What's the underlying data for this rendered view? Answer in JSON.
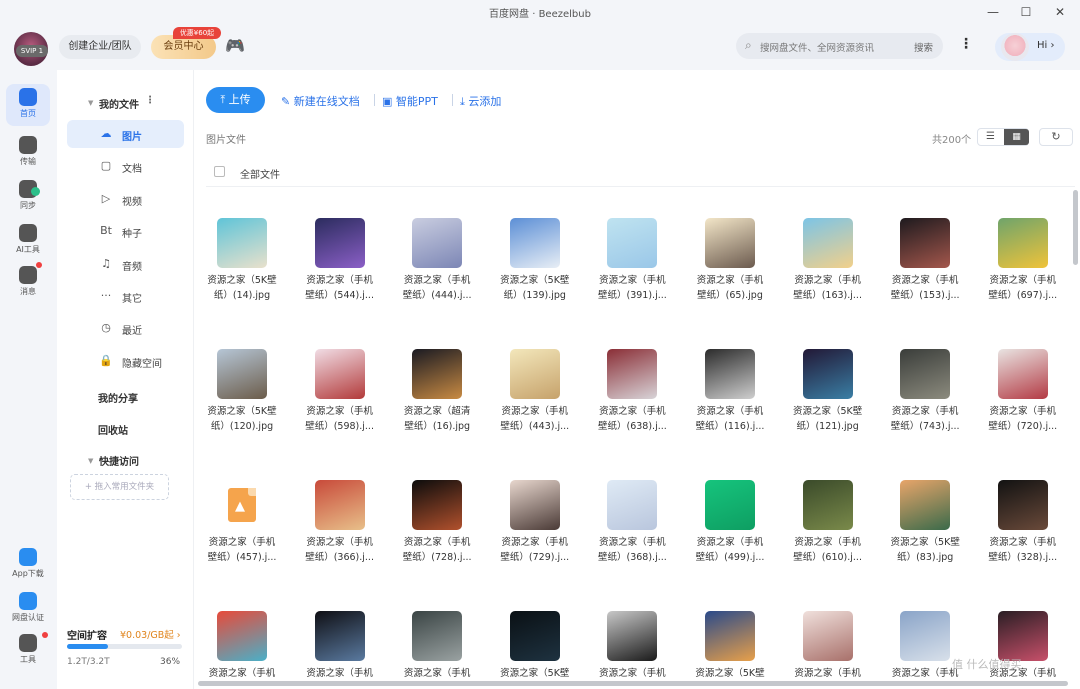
{
  "window": {
    "title": "百度网盘 · Beezelbub",
    "minimize": "—",
    "maximize": "☐",
    "close": "✕"
  },
  "header": {
    "svip": "SVIP 1",
    "team_btn": "创建企业/团队",
    "vip_btn": "会员中心",
    "promo": "优惠¥60起",
    "search_placeholder": "搜网盘文件、全网资源资讯",
    "search_btn": "搜索",
    "more": "⋮",
    "hi": "Hi ›"
  },
  "rail": {
    "items": [
      {
        "label": "首页",
        "color": "#2a72e8"
      },
      {
        "label": "传输",
        "color": "#555555"
      },
      {
        "label": "同步",
        "color": "#555555"
      },
      {
        "label": "AI工具",
        "color": "#555555"
      },
      {
        "label": "消息",
        "color": "#555555"
      }
    ],
    "bottom": [
      {
        "label": "App下载",
        "color": "#2a8df0"
      },
      {
        "label": "网盘认证",
        "color": "#2a8df0"
      },
      {
        "label": "工具",
        "color": "#555555"
      }
    ]
  },
  "sidenav": {
    "my_files": "我的文件",
    "items": [
      {
        "icon": "☁",
        "label": "图片",
        "active": true
      },
      {
        "icon": "▢",
        "label": "文档",
        "active": false
      },
      {
        "icon": "▷",
        "label": "视频",
        "active": false
      },
      {
        "icon": "Bt",
        "label": "种子",
        "active": false
      },
      {
        "icon": "♫",
        "label": "音频",
        "active": false
      },
      {
        "icon": "···",
        "label": "其它",
        "active": false
      },
      {
        "icon": "◷",
        "label": "最近",
        "active": false
      },
      {
        "icon": "🔒",
        "label": "隐藏空间",
        "active": false
      }
    ],
    "my_share": "我的分享",
    "recycle": "回收站",
    "quick_access": "快捷访问",
    "drop_hint": "+ 拖入常用文件夹",
    "quota": {
      "title": "空间扩容",
      "price": "¥0.03/GB起 ›",
      "used": "1.2T/3.2T",
      "pct": "36%",
      "fraction": 0.36
    }
  },
  "toolbar": {
    "upload": "上传",
    "new_doc": "新建在线文档",
    "smart_ppt": "智能PPT",
    "cloud_add": "云添加"
  },
  "list": {
    "crumb": "图片文件",
    "count": "共200个",
    "all_files": "全部文件",
    "list_view": "☰",
    "grid_view": "▦",
    "refresh": "↻"
  },
  "files": [
    {
      "l1": "资源之家（5K壁",
      "l2": "纸）(14).jpg",
      "c1": "#5fc4d8",
      "c2": "#e9e1cc"
    },
    {
      "l1": "资源之家（手机",
      "l2": "壁纸）(544).j...",
      "c1": "#2b2c5e",
      "c2": "#8b5fc7"
    },
    {
      "l1": "资源之家（手机",
      "l2": "壁纸）(444).j...",
      "c1": "#c9cde0",
      "c2": "#7c86b5"
    },
    {
      "l1": "资源之家（5K壁",
      "l2": "纸）(139).jpg",
      "c1": "#5c8fd6",
      "c2": "#e8eef5"
    },
    {
      "l1": "资源之家（手机",
      "l2": "壁纸）(391).j...",
      "c1": "#bfe3f0",
      "c2": "#9ac7e8"
    },
    {
      "l1": "资源之家（手机",
      "l2": "壁纸）(65).jpg",
      "c1": "#f3e6c8",
      "c2": "#6b5a4e"
    },
    {
      "l1": "资源之家（手机",
      "l2": "壁纸）(163).j...",
      "c1": "#7cc4e6",
      "c2": "#f2d08a"
    },
    {
      "l1": "资源之家（手机",
      "l2": "壁纸）(153).j...",
      "c1": "#1e1a1e",
      "c2": "#a4574c"
    },
    {
      "l1": "资源之家（手机",
      "l2": "壁纸）(697).j...",
      "c1": "#6fa46b",
      "c2": "#f0c33a"
    },
    {
      "l1": "资源之家（5K壁",
      "l2": "纸）(120).jpg",
      "c1": "#b6c6d6",
      "c2": "#6b5c4a"
    },
    {
      "l1": "资源之家（手机",
      "l2": "壁纸）(598).j...",
      "c1": "#f1dde5",
      "c2": "#b23a3a"
    },
    {
      "l1": "资源之家（超清",
      "l2": "壁纸）(16).jpg",
      "c1": "#1a1a22",
      "c2": "#c98b43"
    },
    {
      "l1": "资源之家（手机",
      "l2": "壁纸）(443).j...",
      "c1": "#f3e7bb",
      "c2": "#c6a26b"
    },
    {
      "l1": "资源之家（手机",
      "l2": "壁纸）(638).j...",
      "c1": "#8a2e36",
      "c2": "#d8d4d8"
    },
    {
      "l1": "资源之家（手机",
      "l2": "壁纸）(116).j...",
      "c1": "#2b2b2b",
      "c2": "#cfcfcf"
    },
    {
      "l1": "资源之家（5K壁",
      "l2": "纸）(121).jpg",
      "c1": "#221836",
      "c2": "#3a7fa5"
    },
    {
      "l1": "资源之家（手机",
      "l2": "壁纸）(743).j...",
      "c1": "#3a3d3a",
      "c2": "#8c8b7e"
    },
    {
      "l1": "资源之家（手机",
      "l2": "壁纸）(720).j...",
      "c1": "#e9e4e2",
      "c2": "#b33a44"
    },
    {
      "l1": "资源之家（手机",
      "l2": "壁纸）(457).j...",
      "c1": "#ffffff",
      "c2": "#ffffff",
      "doc": true
    },
    {
      "l1": "资源之家（手机",
      "l2": "壁纸）(366).j...",
      "c1": "#c84a3a",
      "c2": "#e8c08a"
    },
    {
      "l1": "资源之家（手机",
      "l2": "壁纸）(728).j...",
      "c1": "#0c0c0c",
      "c2": "#b2512d"
    },
    {
      "l1": "资源之家（手机",
      "l2": "壁纸）(729).j...",
      "c1": "#e8d7ce",
      "c2": "#4a3a36"
    },
    {
      "l1": "资源之家（手机",
      "l2": "壁纸）(368).j...",
      "c1": "#dfeaf5",
      "c2": "#b9c6dd"
    },
    {
      "l1": "资源之家（手机",
      "l2": "壁纸）(499).j...",
      "c1": "#16c47d",
      "c2": "#0e9e62"
    },
    {
      "l1": "资源之家（手机",
      "l2": "壁纸）(610).j...",
      "c1": "#3a4a2a",
      "c2": "#7a8a4a"
    },
    {
      "l1": "资源之家（5K壁",
      "l2": "纸）(83).jpg",
      "c1": "#e8a56a",
      "c2": "#3a6a4a"
    },
    {
      "l1": "资源之家（手机",
      "l2": "壁纸）(328).j...",
      "c1": "#121212",
      "c2": "#6a4a3a"
    },
    {
      "l1": "资源之家（手机",
      "l2": "",
      "c1": "#e84a3a",
      "c2": "#4ab0c8"
    },
    {
      "l1": "资源之家（手机",
      "l2": "",
      "c1": "#0f0f14",
      "c2": "#5a7aa0"
    },
    {
      "l1": "资源之家（手机",
      "l2": "",
      "c1": "#3a4444",
      "c2": "#9aa2a2"
    },
    {
      "l1": "资源之家（5K壁",
      "l2": "",
      "c1": "#0a1014",
      "c2": "#1e3240"
    },
    {
      "l1": "资源之家（手机",
      "l2": "",
      "c1": "#c8c8c8",
      "c2": "#1a1a1a"
    },
    {
      "l1": "资源之家（5K壁",
      "l2": "",
      "c1": "#2a4a8a",
      "c2": "#e8a04a"
    },
    {
      "l1": "资源之家（手机",
      "l2": "",
      "c1": "#f0e0dc",
      "c2": "#a8706a"
    },
    {
      "l1": "资源之家（手机",
      "l2": "",
      "c1": "#8aa4c8",
      "c2": "#d8e0ea"
    },
    {
      "l1": "资源之家（手机",
      "l2": "",
      "c1": "#2a1e24",
      "c2": "#c8506a"
    }
  ],
  "watermark": "值 什么值得买"
}
